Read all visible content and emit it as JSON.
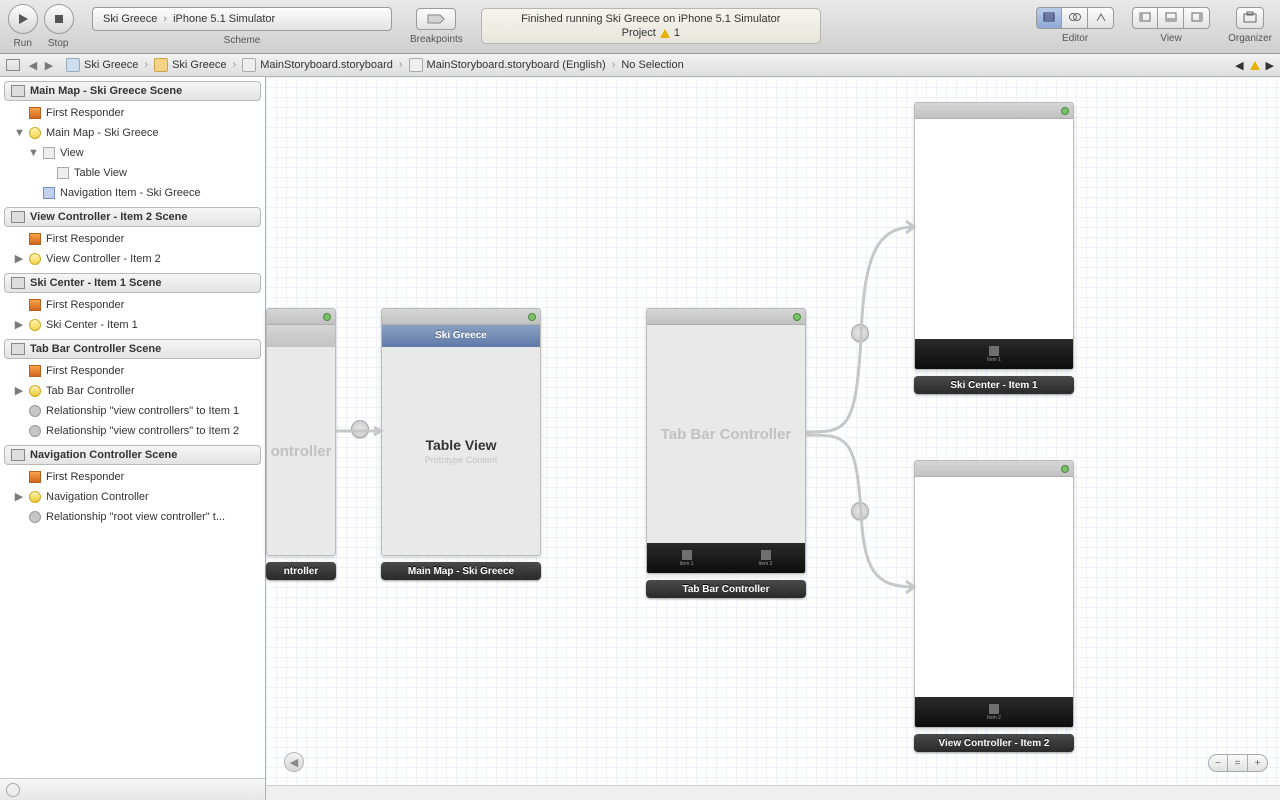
{
  "toolbar": {
    "run": "Run",
    "stop": "Stop",
    "scheme": "Scheme",
    "breakpoints": "Breakpoints",
    "editor": "Editor",
    "view": "View",
    "organizer": "Organizer",
    "scheme_target": "Ski Greece",
    "scheme_dest": "iPhone 5.1 Simulator"
  },
  "status": {
    "main": "Finished running Ski Greece on iPhone 5.1 Simulator",
    "sub_label": "Project",
    "sub_count": "1"
  },
  "jump": {
    "project": "Ski Greece",
    "folder": "Ski Greece",
    "file": "MainStoryboard.storyboard",
    "file_loc": "MainStoryboard.storyboard (English)",
    "sel": "No Selection"
  },
  "outline": {
    "g1": {
      "title": "Main Map - Ski Greece Scene",
      "items": [
        "First Responder",
        "Main Map - Ski Greece",
        "View",
        "Table View",
        "Navigation Item - Ski Greece"
      ]
    },
    "g2": {
      "title": "View Controller - Item 2 Scene",
      "items": [
        "First Responder",
        "View Controller - Item 2"
      ]
    },
    "g3": {
      "title": "Ski Center - Item 1 Scene",
      "items": [
        "First Responder",
        "Ski Center - Item 1"
      ]
    },
    "g4": {
      "title": "Tab Bar Controller Scene",
      "items": [
        "First Responder",
        "Tab Bar Controller",
        "Relationship \"view controllers\" to Item 1",
        "Relationship \"view controllers\" to Item 2"
      ]
    },
    "g5": {
      "title": "Navigation Controller Scene",
      "items": [
        "First Responder",
        "Navigation Controller",
        "Relationship \"root view controller\" t..."
      ]
    }
  },
  "canvas": {
    "nav_controller_wm": "ontroller",
    "nav_controller_label": "ntroller",
    "mainmap_nav": "Ski Greece",
    "mainmap_tv": "Table View",
    "mainmap_tv_sub": "Prototype Content",
    "mainmap_label": "Main Map - Ski Greece",
    "tabbar_wm": "Tab Bar Controller",
    "tabbar_label": "Tab Bar Controller",
    "tab1": "Item 1",
    "tab2": "Item 2",
    "ski_label": "Ski Center - Item 1",
    "vc2_label": "View Controller - Item 2"
  }
}
